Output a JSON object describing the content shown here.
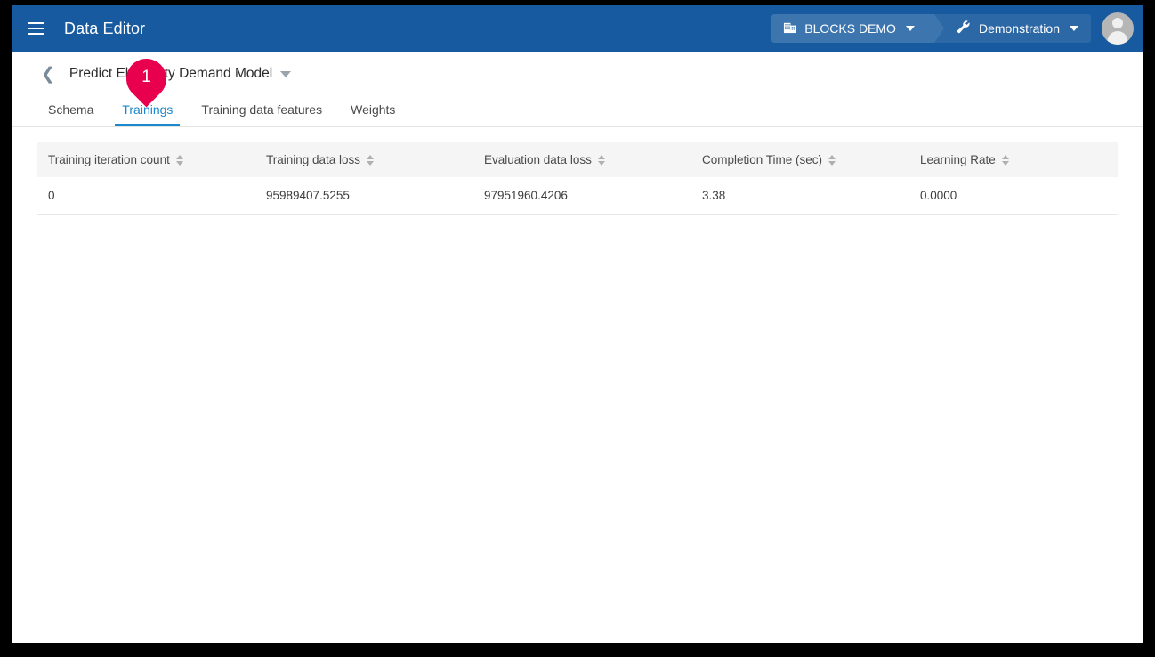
{
  "appbar": {
    "menu_icon": "hamburger-menu-icon",
    "title": "Data Editor",
    "org_chip": {
      "icon": "building-icon",
      "label": "BLOCKS DEMO",
      "caret": "chevron-down-icon"
    },
    "env_chip": {
      "icon": "wrench-icon",
      "label": "Demonstration",
      "caret": "chevron-down-icon"
    },
    "avatar": "user-avatar-icon",
    "background_color": "#175AA0"
  },
  "subheader": {
    "back_icon": "chevron-left-icon",
    "model_title": "Predict Electricity Demand Model",
    "title_caret": "chevron-down-icon"
  },
  "tabs": [
    {
      "label": "Schema",
      "active": false
    },
    {
      "label": "Trainings",
      "active": true
    },
    {
      "label": "Training data features",
      "active": false
    },
    {
      "label": "Weights",
      "active": false
    }
  ],
  "tab_accent_color": "#1B87CC",
  "table": {
    "columns": [
      "Training iteration count",
      "Training data loss",
      "Evaluation data loss",
      "Completion Time (sec)",
      "Learning Rate"
    ],
    "sort_icon": "sort-updown-icon",
    "rows": [
      [
        "0",
        "95989407.5255",
        "97951960.4206",
        "3.38",
        "0.0000"
      ]
    ]
  },
  "pin_marker": {
    "label": "1",
    "color": "#E8004F"
  }
}
